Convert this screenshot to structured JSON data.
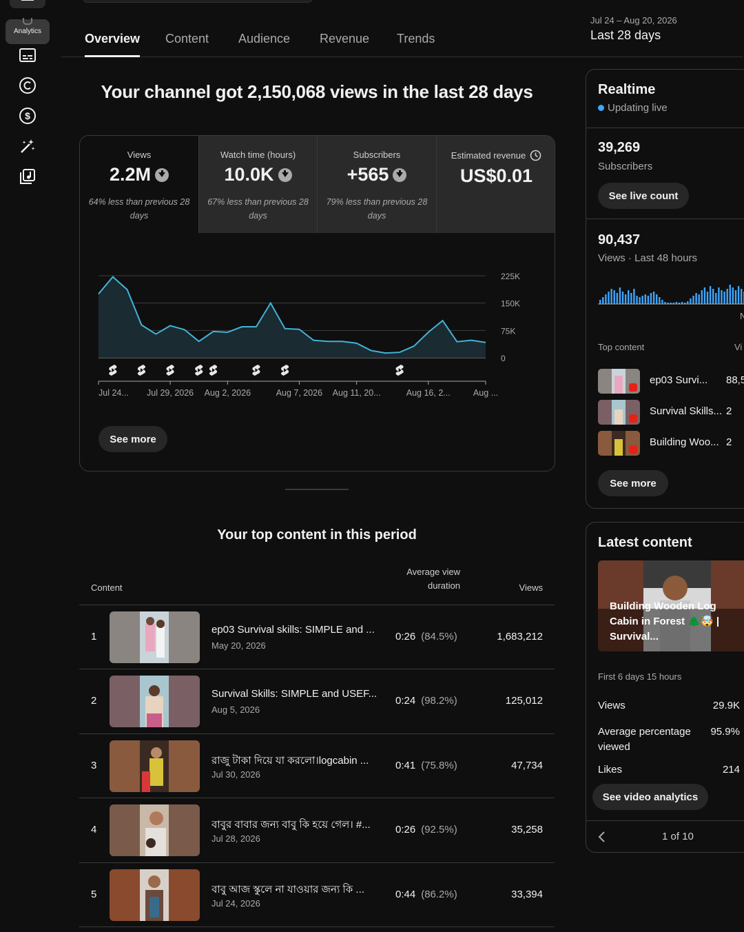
{
  "nav": {
    "active_label": "Analytics"
  },
  "tabs": [
    {
      "label": "Overview"
    },
    {
      "label": "Content"
    },
    {
      "label": "Audience"
    },
    {
      "label": "Revenue"
    },
    {
      "label": "Trends"
    }
  ],
  "date_range": {
    "dates": "Jul 24 – Aug 20, 2026",
    "label": "Last 28 days"
  },
  "headline": "Your channel got 2,150,068 views in the last 28 days",
  "metrics": [
    {
      "label": "Views",
      "value": "2.2M",
      "note": "64% less than previous 28 days"
    },
    {
      "label": "Watch time (hours)",
      "value": "10.0K",
      "note": "67% less than previous 28 days"
    },
    {
      "label": "Subscribers",
      "value": "+565",
      "note": "79% less than previous 28 days"
    },
    {
      "label": "Estimated revenue",
      "value": "US$0.01",
      "note": ""
    }
  ],
  "chart_data": {
    "type": "area",
    "x": [
      "Jul 24",
      "Jul 25",
      "Jul 26",
      "Jul 27",
      "Jul 28",
      "Jul 29",
      "Jul 30",
      "Jul 31",
      "Aug 1",
      "Aug 2",
      "Aug 3",
      "Aug 4",
      "Aug 5",
      "Aug 6",
      "Aug 7",
      "Aug 8",
      "Aug 9",
      "Aug 10",
      "Aug 11",
      "Aug 12",
      "Aug 13",
      "Aug 14",
      "Aug 15",
      "Aug 16",
      "Aug 17",
      "Aug 18",
      "Aug 19",
      "Aug 20"
    ],
    "values": [
      175000,
      222000,
      187000,
      90000,
      65000,
      88000,
      77000,
      45000,
      72000,
      70000,
      85000,
      85000,
      150000,
      80000,
      78000,
      48000,
      45000,
      45000,
      40000,
      20000,
      13000,
      15000,
      32000,
      70000,
      102000,
      44000,
      48000,
      42000
    ],
    "ylim": [
      0,
      225000
    ],
    "yticks": [
      "225K",
      "150K",
      "75K",
      "0"
    ],
    "ytick_values": [
      225000,
      150000,
      75000,
      0
    ],
    "xtick_labels": [
      "Jul 24...",
      "Jul 29, 2026",
      "Aug 2, 2026",
      "Aug 7, 2026",
      "Aug 11, 20...",
      "Aug 16, 2...",
      "Aug ..."
    ],
    "xtick_days": [
      0,
      5,
      9,
      14,
      18,
      23,
      27
    ],
    "upload_marker_days": [
      1,
      3,
      5,
      7,
      8,
      11,
      13,
      21
    ],
    "grid": true,
    "line_color": "#41b4d9",
    "fill_color": "#1b2b32"
  },
  "card": {
    "see_more": "See more"
  },
  "top_content": {
    "title": "Your top content in this period",
    "headers": {
      "content": "Content",
      "avd": "Average view duration",
      "views": "Views"
    },
    "rows": [
      {
        "rank": "1",
        "title": "ep03 Survival skills: SIMPLE and ...",
        "date": "May 20, 2026",
        "avd": "0:26",
        "pct": "(84.5%)",
        "views": "1,683,212"
      },
      {
        "rank": "2",
        "title": "Survival Skills: SIMPLE and USEF...",
        "date": "Aug 5, 2026",
        "avd": "0:24",
        "pct": "(98.2%)",
        "views": "125,012"
      },
      {
        "rank": "3",
        "title": "রাজু টাকা দিয়ে যা করলো।logcabin ...",
        "date": "Jul 30, 2026",
        "avd": "0:41",
        "pct": "(75.8%)",
        "views": "47,734"
      },
      {
        "rank": "4",
        "title": "বাবুর বাবার জন্য বাবু কি হয়ে গেল। #...",
        "date": "Jul 28, 2026",
        "avd": "0:26",
        "pct": "(92.5%)",
        "views": "35,258"
      },
      {
        "rank": "5",
        "title": "বাবু আজ স্কুলে না যাওয়ার জন্য কি ...",
        "date": "Jul 24, 2026",
        "avd": "0:44",
        "pct": "(86.2%)",
        "views": "33,394"
      }
    ]
  },
  "realtime": {
    "title": "Realtime",
    "status": "Updating live",
    "subscribers_value": "39,269",
    "subscribers_label": "Subscribers",
    "see_live_count": "See live count",
    "views_value": "90,437",
    "views_label": "Views · Last 48 hours",
    "spark_axis_label": "N",
    "top_content_label": "Top content",
    "top_content_views_header": "Vi",
    "items": [
      {
        "title": "ep03 Survi...",
        "views": "88,5"
      },
      {
        "title": "Survival Skills...",
        "views": "2"
      },
      {
        "title": "Building Woo...",
        "views": "2"
      }
    ],
    "see_more": "See more"
  },
  "latest": {
    "title": "Latest content",
    "video_title": "Building Wooden Log Cabin in Forest 🌲🤯 | Survival...",
    "period": "First 6 days 15 hours",
    "stats": [
      {
        "label": "Views",
        "value": "29.9K"
      },
      {
        "label": "Average percentage viewed",
        "value": "95.9%"
      },
      {
        "label": "Likes",
        "value": "214"
      }
    ],
    "see_video_analytics": "See video analytics",
    "pager": "1 of 10"
  }
}
